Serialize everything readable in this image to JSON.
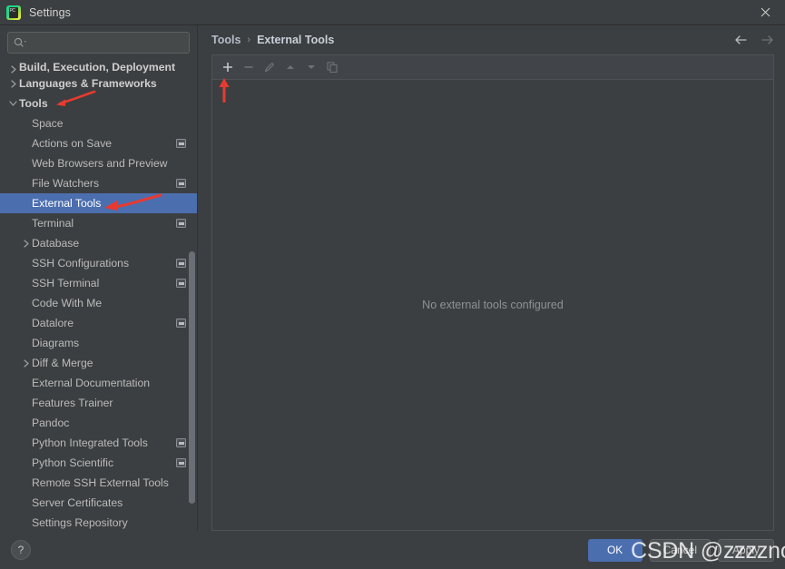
{
  "window": {
    "title": "Settings",
    "app_icon": "pycharm-icon",
    "close_icon": "close-icon"
  },
  "search": {
    "value": "",
    "placeholder": "",
    "icon": "search-icon"
  },
  "sidebar": {
    "items": [
      {
        "label": "Build, Execution, Deployment",
        "level": 0,
        "arrow": "chevron-right",
        "bold": true,
        "badge": false,
        "selected": false,
        "clipped": true
      },
      {
        "label": "Languages & Frameworks",
        "level": 0,
        "arrow": "chevron-right",
        "bold": true,
        "badge": false,
        "selected": false
      },
      {
        "label": "Tools",
        "level": 0,
        "arrow": "chevron-down",
        "bold": true,
        "badge": false,
        "selected": false
      },
      {
        "label": "Space",
        "level": 1,
        "arrow": "",
        "bold": false,
        "badge": false,
        "selected": false
      },
      {
        "label": "Actions on Save",
        "level": 1,
        "arrow": "",
        "bold": false,
        "badge": true,
        "selected": false
      },
      {
        "label": "Web Browsers and Preview",
        "level": 1,
        "arrow": "",
        "bold": false,
        "badge": false,
        "selected": false
      },
      {
        "label": "File Watchers",
        "level": 1,
        "arrow": "",
        "bold": false,
        "badge": true,
        "selected": false
      },
      {
        "label": "External Tools",
        "level": 1,
        "arrow": "",
        "bold": false,
        "badge": false,
        "selected": true
      },
      {
        "label": "Terminal",
        "level": 1,
        "arrow": "",
        "bold": false,
        "badge": true,
        "selected": false
      },
      {
        "label": "Database",
        "level": 1,
        "arrow": "chevron-right",
        "bold": false,
        "badge": false,
        "selected": false
      },
      {
        "label": "SSH Configurations",
        "level": 1,
        "arrow": "",
        "bold": false,
        "badge": true,
        "selected": false
      },
      {
        "label": "SSH Terminal",
        "level": 1,
        "arrow": "",
        "bold": false,
        "badge": true,
        "selected": false
      },
      {
        "label": "Code With Me",
        "level": 1,
        "arrow": "",
        "bold": false,
        "badge": false,
        "selected": false
      },
      {
        "label": "Datalore",
        "level": 1,
        "arrow": "",
        "bold": false,
        "badge": true,
        "selected": false
      },
      {
        "label": "Diagrams",
        "level": 1,
        "arrow": "",
        "bold": false,
        "badge": false,
        "selected": false
      },
      {
        "label": "Diff & Merge",
        "level": 1,
        "arrow": "chevron-right",
        "bold": false,
        "badge": false,
        "selected": false
      },
      {
        "label": "External Documentation",
        "level": 1,
        "arrow": "",
        "bold": false,
        "badge": false,
        "selected": false
      },
      {
        "label": "Features Trainer",
        "level": 1,
        "arrow": "",
        "bold": false,
        "badge": false,
        "selected": false
      },
      {
        "label": "Pandoc",
        "level": 1,
        "arrow": "",
        "bold": false,
        "badge": false,
        "selected": false
      },
      {
        "label": "Python Integrated Tools",
        "level": 1,
        "arrow": "",
        "bold": false,
        "badge": true,
        "selected": false
      },
      {
        "label": "Python Scientific",
        "level": 1,
        "arrow": "",
        "bold": false,
        "badge": true,
        "selected": false
      },
      {
        "label": "Remote SSH External Tools",
        "level": 1,
        "arrow": "",
        "bold": false,
        "badge": false,
        "selected": false
      },
      {
        "label": "Server Certificates",
        "level": 1,
        "arrow": "",
        "bold": false,
        "badge": false,
        "selected": false
      },
      {
        "label": "Settings Repository",
        "level": 1,
        "arrow": "",
        "bold": false,
        "badge": false,
        "selected": false
      }
    ]
  },
  "breadcrumb": {
    "parent": "Tools",
    "separator": "›",
    "current": "External Tools",
    "back_icon": "arrow-left-icon",
    "forward_icon": "arrow-right-icon"
  },
  "toolbar": {
    "buttons": [
      {
        "name": "add-button",
        "icon": "plus-icon",
        "enabled": true
      },
      {
        "name": "remove-button",
        "icon": "minus-icon",
        "enabled": false
      },
      {
        "name": "edit-button",
        "icon": "pencil-icon",
        "enabled": false
      },
      {
        "name": "move-up-button",
        "icon": "arrow-up-icon",
        "enabled": false
      },
      {
        "name": "move-down-button",
        "icon": "arrow-down-icon",
        "enabled": false
      },
      {
        "name": "copy-button",
        "icon": "copy-icon",
        "enabled": false
      }
    ]
  },
  "main": {
    "empty_message": "No external tools configured"
  },
  "footer": {
    "help_label": "?",
    "ok_label": "OK",
    "cancel_label": "Cancel",
    "apply_label": "Apply"
  },
  "annotations": {
    "watermark": "CSDN @zzzznone",
    "arrow_color": "#e83a30"
  },
  "colors": {
    "background": "#3c3f41",
    "selection": "#4b6eaf",
    "primary_button": "#4b6eaf",
    "text": "#bbbbbb",
    "muted_text": "#8e9295"
  }
}
